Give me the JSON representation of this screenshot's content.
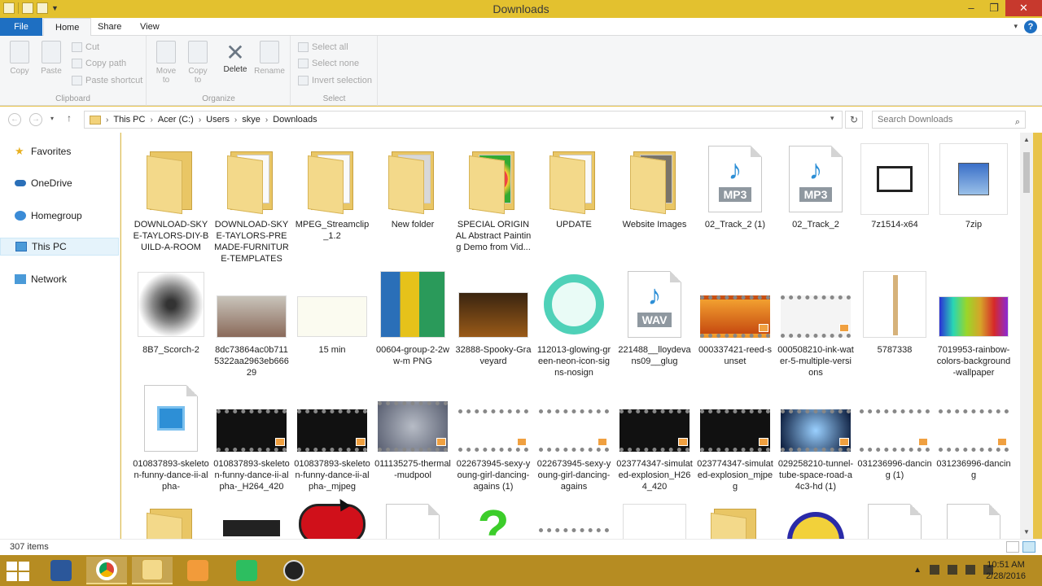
{
  "window": {
    "title": "Downloads",
    "controls": {
      "minimize": "–",
      "maximize": "❐",
      "close": "✕"
    }
  },
  "ribbon": {
    "tabs": [
      "File",
      "Home",
      "Share",
      "View"
    ],
    "help": "?",
    "clipboard": {
      "label": "Clipboard",
      "copy": "Copy",
      "paste": "Paste",
      "cut": "Cut",
      "copy_path": "Copy path",
      "paste_shortcut": "Paste shortcut"
    },
    "organize": {
      "label": "Organize",
      "move_to": "Move\nto",
      "copy_to": "Copy\nto",
      "delete": "Delete",
      "rename": "Rename"
    },
    "select": {
      "label": "Select",
      "select_all": "Select all",
      "select_none": "Select none",
      "invert": "Invert selection"
    }
  },
  "address": {
    "crumbs": [
      "This PC",
      "Acer (C:)",
      "Users",
      "skye",
      "Downloads"
    ],
    "search_placeholder": "Search Downloads"
  },
  "nav": {
    "items": [
      "Favorites",
      "OneDrive",
      "Homegroup",
      "This PC",
      "Network"
    ],
    "selected": "This PC"
  },
  "files": {
    "row1": [
      {
        "name": "DOWNLOAD-SKYE-TAYLORS-DIY-BUILD-A-ROOM",
        "kind": "folder"
      },
      {
        "name": "DOWNLOAD-SKYE-TAYLORS-PREMADE-FURNITURE-TEMPLATES",
        "kind": "folder"
      },
      {
        "name": "MPEG_Streamclip_1.2",
        "kind": "folder"
      },
      {
        "name": "New folder",
        "kind": "folder"
      },
      {
        "name": "SPECIAL ORIGINAL Abstract Painting Demo from Vid...",
        "kind": "folder"
      },
      {
        "name": "UPDATE",
        "kind": "folder"
      },
      {
        "name": "Website Images",
        "kind": "folder"
      },
      {
        "name": "02_Track_2 (1)",
        "kind": "mp3"
      },
      {
        "name": "02_Track_2",
        "kind": "mp3"
      },
      {
        "name": "7z1514-x64",
        "kind": "exe"
      },
      {
        "name": "7zip",
        "kind": "exe"
      }
    ],
    "row2": [
      {
        "name": "8B7_Scorch-2",
        "kind": "image"
      },
      {
        "name": "8dc73864ac0b7115322aa2963eb66629",
        "kind": "image"
      },
      {
        "name": "15 min",
        "kind": "image"
      },
      {
        "name": "00604-group-2-2ww-m PNG",
        "kind": "image"
      },
      {
        "name": "32888-Spooky-Graveyard",
        "kind": "image"
      },
      {
        "name": "112013-glowing-green-neon-icon-signs-nosign",
        "kind": "image"
      },
      {
        "name": "221488__lloydevans09__glug",
        "kind": "wav"
      },
      {
        "name": "000337421-reed-sunset",
        "kind": "video"
      },
      {
        "name": "000508210-ink-water-5-multiple-versions",
        "kind": "video"
      },
      {
        "name": "5787338",
        "kind": "image"
      },
      {
        "name": "7019953-rainbow-colors-background-wallpaper",
        "kind": "image"
      }
    ],
    "row3": [
      {
        "name": "010837893-skeleton-funny-dance-ii-alpha-",
        "kind": "media"
      },
      {
        "name": "010837893-skeleton-funny-dance-ii-alpha-_H264_420",
        "kind": "video"
      },
      {
        "name": "010837893-skeleton-funny-dance-ii-alpha-_mjpeg",
        "kind": "video"
      },
      {
        "name": "011135275-thermal-mudpool",
        "kind": "video"
      },
      {
        "name": "022673945-sexy-young-girl-dancing-agains (1)",
        "kind": "video"
      },
      {
        "name": "022673945-sexy-young-girl-dancing-agains",
        "kind": "video"
      },
      {
        "name": "023774347-simulated-explosion_H264_420",
        "kind": "video"
      },
      {
        "name": "023774347-simulated-explosion_mjpeg",
        "kind": "video"
      },
      {
        "name": "029258210-tunnel-tube-space-road-a4c3-hd (1)",
        "kind": "video"
      },
      {
        "name": "031236996-dancing (1)",
        "kind": "video"
      },
      {
        "name": "031236996-dancing",
        "kind": "video"
      }
    ],
    "file_types": {
      "mp3": "MP3",
      "wav": "WAV"
    }
  },
  "status": {
    "count": "307 items"
  },
  "taskbar": {
    "time": "10:51 AM",
    "date": "2/28/2016",
    "apps": [
      "word-icon",
      "chrome-icon",
      "file-explorer-icon",
      "media-player-icon",
      "evernote-icon",
      "obs-icon"
    ]
  },
  "colors": {
    "title_bar": "#e3c12f",
    "file_tab": "#1e6fc2",
    "taskbar": "#b0861e",
    "selection": "#e5f3fb"
  }
}
